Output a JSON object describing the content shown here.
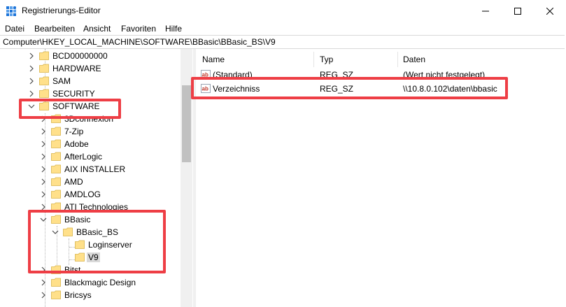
{
  "window": {
    "title": "Registrierungs-Editor",
    "accent": "#1a73d9",
    "highlight_color": "#ee3e45",
    "folder_color": "#ffe08a"
  },
  "menu": [
    "Datei",
    "Bearbeiten",
    "Ansicht",
    "Favoriten",
    "Hilfe"
  ],
  "address": "Computer\\HKEY_LOCAL_MACHINE\\SOFTWARE\\BBasic\\BBasic_BS\\V9",
  "tree": [
    {
      "label": "BCD00000000",
      "expanded": false,
      "selected": false
    },
    {
      "label": "HARDWARE",
      "expanded": false,
      "selected": false
    },
    {
      "label": "SAM",
      "expanded": false,
      "selected": false
    },
    {
      "label": "SECURITY",
      "expanded": false,
      "selected": false
    },
    {
      "label": "SOFTWARE",
      "expanded": true,
      "selected": false
    },
    {
      "label": "3Dconnexion",
      "expanded": false,
      "selected": false
    },
    {
      "label": "7-Zip",
      "expanded": false,
      "selected": false
    },
    {
      "label": "Adobe",
      "expanded": false,
      "selected": false
    },
    {
      "label": "AfterLogic",
      "expanded": false,
      "selected": false
    },
    {
      "label": "AIX INSTALLER",
      "expanded": false,
      "selected": false
    },
    {
      "label": "AMD",
      "expanded": false,
      "selected": false
    },
    {
      "label": "AMDLOG",
      "expanded": false,
      "selected": false
    },
    {
      "label": "ATI Technologies",
      "expanded": false,
      "selected": false
    },
    {
      "label": "BBasic",
      "expanded": true,
      "selected": false
    },
    {
      "label": "BBasic_BS",
      "expanded": true,
      "selected": false
    },
    {
      "label": "Loginserver",
      "expanded": null,
      "selected": false
    },
    {
      "label": "V9",
      "expanded": null,
      "selected": true
    },
    {
      "label": "Bitst",
      "expanded": false,
      "selected": false
    },
    {
      "label": "Blackmagic Design",
      "expanded": false,
      "selected": false
    },
    {
      "label": "Bricsys",
      "expanded": false,
      "selected": false
    }
  ],
  "columns": {
    "name": "Name",
    "type": "Typ",
    "data": "Daten"
  },
  "values": [
    {
      "name": "(Standard)",
      "type": "REG_SZ",
      "data": "(Wert nicht festgelegt)",
      "icon": "string-value-icon"
    },
    {
      "name": "Verzeichniss",
      "type": "REG_SZ",
      "data": "\\\\10.8.0.102\\daten\\bbasic",
      "icon": "string-value-icon"
    }
  ]
}
